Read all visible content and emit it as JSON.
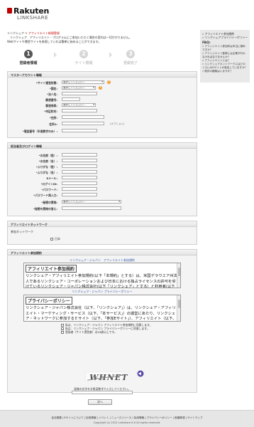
{
  "brand": {
    "name": "Rakuten",
    "sub": "LINKSHARE",
    "mark": "R"
  },
  "breadcrumb": {
    "home": "リンクシェア",
    "sep": " > ",
    "current": "アフィリエイト新規登録"
  },
  "intro": [
    "　リンクシェア　アフィリエイト・プログラムにご参加いただく場合の案内は一切かかりません。",
    "Webサイトや運営サイトを参照していれば簡単に始めることができます。"
  ],
  "steps": [
    {
      "num": "1",
      "label": "登録者情報"
    },
    {
      "num": "2",
      "label": "サイト情報"
    },
    {
      "num": "3",
      "label": "登録完了"
    }
  ],
  "master": {
    "title": "マスターアカウント情報",
    "rows": [
      {
        "label": "*サイト運営形態:",
        "type": "select",
        "value": "選択してください...",
        "help": true
      },
      {
        "label": "*国名:",
        "type": "select",
        "value": "選択してください...",
        "help": true
      },
      {
        "label": "*法人名:",
        "type": "text"
      },
      {
        "label": "郵便番号:",
        "type": "text"
      },
      {
        "label": "都道府県:",
        "type": "select",
        "value": "選択してください..."
      },
      {
        "label": "*市区町村:",
        "type": "text"
      },
      {
        "label": "*住所:",
        "type": "text"
      },
      {
        "label": "住所2:",
        "type": "text",
        "note": "(オプション)"
      },
      {
        "label": "*電話番号（半角数字のみ）:",
        "type": "text"
      }
    ],
    "help_glyph": "?"
  },
  "person": {
    "title": "担当者及びログイン情報",
    "rows": [
      {
        "label": "*お名前（姓）:",
        "type": "text"
      },
      {
        "label": "*お名前（名）:",
        "type": "text"
      },
      {
        "label": "*ふりがな（姓）:",
        "type": "text"
      },
      {
        "label": "*ふりがな（名）:",
        "type": "text"
      },
      {
        "label": "Eメール:",
        "type": "text"
      },
      {
        "label": "*ログインID:",
        "type": "text"
      },
      {
        "label": "*パスワード:",
        "type": "text"
      },
      {
        "label": "*パスワード再入力:",
        "type": "text"
      },
      {
        "label": "*秘密の質問:",
        "type": "select",
        "value": "選択してください..."
      },
      {
        "label": "*秘密の質問の答え:",
        "type": "text"
      }
    ]
  },
  "network": {
    "title": "アフィリエイトネットワーク",
    "label": "参加ネットワーク",
    "option": "日本"
  },
  "agreement": {
    "title": "アフィリエイト参加規約",
    "terms_link": "リンクシェア・ジャパン　アフィリエイト参加規約",
    "terms_heading": "アフィリエイト参加規約",
    "terms_text": "リンクシェア・アフィリエイト参加規約(以下「本規約」とする）は、米国デラウエア州法人であるリンクシェア・コーポレーションおよび日本における独占ライセンスの許可を受けているリンクシェア・ジャパン株式会社(以下「リンクシェア」とする）と利用者(以下「アフィリエイト」とする)との間で締結されます。アフィリエイトが、法人を代表して登録されている場合は、その法人の代表として本規約に同意されたものと",
    "privacy_link": "リンクシェア・ジャパン プライバシーポリシー",
    "privacy_heading": "プライバシーポリシー",
    "privacy_text": "リンクシェア・ジャパン株式会社（以下、「リンクシェア」）は、リンクシェア・アフィリエイト・マーケティング・サービス（以下、「本サービス」）の運営にあたり、リンクシェア・ネットワークに参加するＥサイト（以下、「参加Eサイト」）、アフィリエイト（以下、「参加アフィリエイト」）、およびEサービスに関連してリンクシェアが実施するアンケート、キャンペーン、イベントなど各種企画に応募したもの",
    "checks": [
      "私は、リンクシェア・ジャパン アフィリエイト参加規約に同意します。",
      "私は、リンクシェア・ジャパン プライバシーポリシーに同意します。",
      "登録者（サイト運営者）は18歳以上です。"
    ],
    "captcha_text": "WHNET",
    "captcha_label": "画像の文字を半角英数字で入力してください。"
  },
  "next_button": "次へ",
  "sidebar": {
    "links": [
      "アフィリエイト参加規約",
      "リンクシェアプライバシーポリシー"
    ],
    "faq_title": "FAQ:",
    "faq": [
      "アフィリエイト参加料は本当に無料ですか？",
      "アフィリエイト登録には企業が行わなければなりませんか？",
      "アフィリエイトとは？",
      "リンクシェアネットワークにはどのくらいのEサイトが参加していますか？",
      "既存の顧客はいますか？"
    ]
  },
  "footer": {
    "links": "会社概要 | Eサイトについて | 採用情報 | イベント | ニュースリリース | 採用情報 | プライバシーポリシー | 各種事項 | サイトマップ",
    "copyright": "Copyright (c) 2012 Linkshare K.K All rights reserved."
  }
}
